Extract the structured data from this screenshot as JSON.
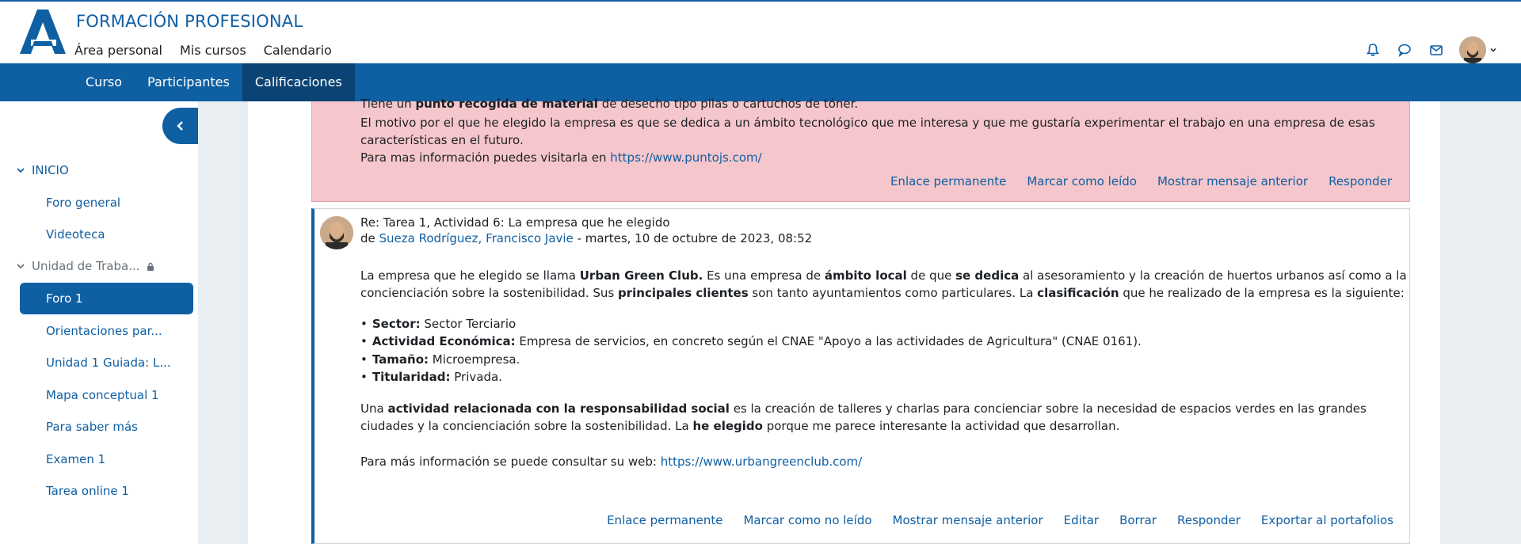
{
  "header": {
    "site_title": "FORMACIÓN PROFESIONAL",
    "nav": [
      "Área personal",
      "Mis cursos",
      "Calendario"
    ]
  },
  "secondary_nav": {
    "tabs": [
      "Curso",
      "Participantes",
      "Calificaciones"
    ],
    "active": "Calificaciones"
  },
  "sidebar": {
    "section_inicio": "INICIO",
    "foro_general": "Foro general",
    "videoteca": "Videoteca",
    "section_unidad": "Unidad de Traba...",
    "active_item": "Foro 1",
    "items": [
      "Orientaciones par...",
      "Unidad 1 Guiada: L...",
      "Mapa conceptual 1",
      "Para saber más",
      "Examen 1",
      "Tarea online 1"
    ]
  },
  "previous_post": {
    "line0_a": "Tiene un ",
    "line0_b": "punto recogida de material",
    "line0_c": " de desecho tipo pilas o cartuchos de tóner.",
    "line1": "El motivo por el que he elegido la empresa es que se dedica a un ámbito tecnológico que me interesa y que me gustaría experimentar el trabajo en una empresa de esas",
    "line2": "características en el futuro.",
    "line3_a": "Para mas información puedes visitarla en ",
    "line3_link": "https://www.puntojs.com/",
    "commands": [
      "Enlace permanente",
      "Marcar como leído",
      "Mostrar mensaje anterior",
      "Responder"
    ]
  },
  "reply": {
    "subject": "Re: Tarea 1, Actividad 6: La empresa que he elegido",
    "by": "de ",
    "author": "Sueza Rodríguez, Francisco Javie",
    "date": " - martes, 10 de octubre de 2023, 08:52",
    "p1_l1_a": "La empresa que he elegido se llama ",
    "p1_l1_b": "Urban Green Club.",
    "p1_l1_c": " Es una empresa de ",
    "p1_l1_d": "ámbito local",
    "p1_l1_e": " de que ",
    "p1_l1_f": "se dedica",
    "p1_l1_g": " al asesoramiento y la creación de huertos urbanos así como a la",
    "p1_l2_a": "concienciación sobre la sostenibilidad. Sus ",
    "p1_l2_b": "principales clientes",
    "p1_l2_c": " son tanto ayuntamientos como particulares. La ",
    "p1_l2_d": "clasificación",
    "p1_l2_e": " que he realizado de la empresa es la siguiente:",
    "bullets": [
      {
        "label": "Sector:",
        "text": " Sector Terciario"
      },
      {
        "label": "Actividad Económica:",
        "text": " Empresa de servicios, en concreto según el CNAE \"Apoyo a las actividades de Agricultura\" (CNAE 0161)."
      },
      {
        "label": "Tamaño:",
        "text": " Microempresa."
      },
      {
        "label": "Titularidad:",
        "text": " Privada."
      }
    ],
    "p2_l1_a": "Una ",
    "p2_l1_b": "actividad relacionada con la responsabilidad social",
    "p2_l1_c": " es la creación de talleres y charlas para concienciar sobre la necesidad de espacios verdes en las grandes",
    "p2_l2_a": "ciudades y la concienciación sobre la sostenibilidad. La ",
    "p2_l2_b": "he elegido",
    "p2_l2_c": " porque me parece interesante la actividad que desarrollan.",
    "p3_a": "Para más información se puede consultar su web: ",
    "p3_link": "https://www.urbangreenclub.com/",
    "commands": [
      "Enlace permanente",
      "Marcar como no leído",
      "Mostrar mensaje anterior",
      "Editar",
      "Borrar",
      "Responder",
      "Exportar al portafolios"
    ]
  },
  "colors": {
    "brand": "#0f5fa3",
    "brand_dark": "#0b4474",
    "unread_bg": "#f5c6cb"
  }
}
